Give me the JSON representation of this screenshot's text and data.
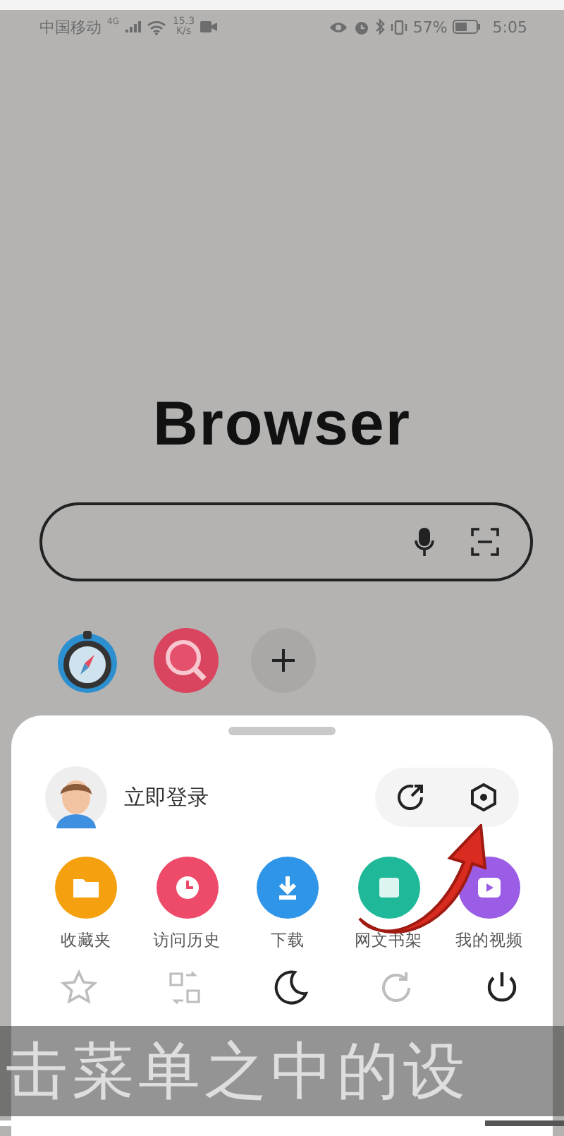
{
  "status_bar": {
    "carrier": "中国移动",
    "network": "4G",
    "speed_value": "15.3",
    "speed_unit": "K/s",
    "battery": "57%",
    "time": "5:05"
  },
  "logo": "Browser",
  "shortcuts": [
    {
      "kind": "compass"
    },
    {
      "kind": "magnifier"
    },
    {
      "kind": "add"
    }
  ],
  "menu": {
    "login": "立即登录",
    "items": [
      {
        "label": "收藏夹",
        "kind": "folder",
        "color": "#f5a00f"
      },
      {
        "label": "访问历史",
        "kind": "clock",
        "color": "#ee4b6a"
      },
      {
        "label": "下载",
        "kind": "download",
        "color": "#2f95e8"
      },
      {
        "label": "网文书架",
        "kind": "book",
        "color": "#1fb99a"
      },
      {
        "label": "我的视频",
        "kind": "video",
        "color": "#9b5de5"
      }
    ],
    "tools": [
      {
        "kind": "star",
        "disabled": true
      },
      {
        "kind": "translate",
        "disabled": true
      },
      {
        "kind": "moon",
        "disabled": false
      },
      {
        "kind": "refresh",
        "disabled": true
      },
      {
        "kind": "power",
        "disabled": false
      }
    ]
  },
  "subtitle": "击菜单之中的设",
  "video_progress": {
    "level": 0.86
  }
}
